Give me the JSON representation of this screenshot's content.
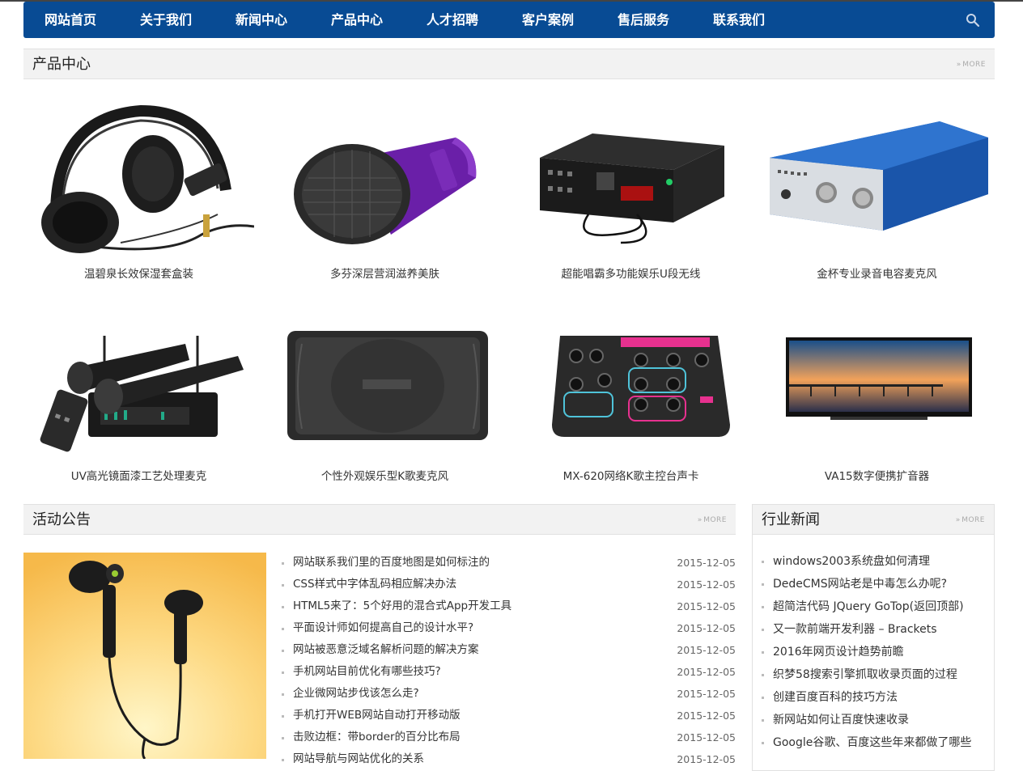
{
  "nav": {
    "items": [
      "网站首页",
      "关于我们",
      "新闻中心",
      "产品中心",
      "人才招聘",
      "客户案例",
      "售后服务",
      "联系我们"
    ]
  },
  "products_section": {
    "title": "产品中心",
    "more": "MORE",
    "items": [
      {
        "name": "温碧泉长效保湿套盒装",
        "icon": "headphones-image"
      },
      {
        "name": "多芬深层营润滋养美肤",
        "icon": "microphone-image"
      },
      {
        "name": "超能唱霸多功能娱乐U段无线",
        "icon": "amplifier-image"
      },
      {
        "name": "金杯专业录音电容麦克风",
        "icon": "audio-interface-image"
      },
      {
        "name": "UV高光镜面漆工艺处理麦克",
        "icon": "wireless-mic-set-image"
      },
      {
        "name": "个性外观娱乐型K歌麦克风",
        "icon": "speaker-image"
      },
      {
        "name": "MX-620网络K歌主控台声卡",
        "icon": "mixer-image"
      },
      {
        "name": "VA15数字便携扩音器",
        "icon": "tv-image"
      }
    ]
  },
  "notice_section": {
    "title": "活动公告",
    "more": "MORE",
    "items": [
      {
        "title": "网站联系我们里的百度地图是如何标注的",
        "date": "2015-12-05"
      },
      {
        "title": "CSS样式中字体乱码相应解决办法",
        "date": "2015-12-05"
      },
      {
        "title": "HTML5来了：5个好用的混合式App开发工具",
        "date": "2015-12-05"
      },
      {
        "title": "平面设计师如何提高自己的设计水平?",
        "date": "2015-12-05"
      },
      {
        "title": "网站被恶意泛域名解析问题的解决方案",
        "date": "2015-12-05"
      },
      {
        "title": "手机网站目前优化有哪些技巧?",
        "date": "2015-12-05"
      },
      {
        "title": "企业微网站步伐该怎么走?",
        "date": "2015-12-05"
      },
      {
        "title": "手机打开WEB网站自动打开移动版",
        "date": "2015-12-05"
      },
      {
        "title": "击败边框：带border的百分比布局",
        "date": "2015-12-05"
      },
      {
        "title": "网站导航与网站优化的关系",
        "date": "2015-12-05"
      }
    ]
  },
  "news_section": {
    "title": "行业新闻",
    "more": "MORE",
    "items": [
      "windows2003系统盘如何清理",
      "DedeCMS网站老是中毒怎么办呢?",
      "超简洁代码 JQuery GoTop(返回顶部)",
      "又一款前端开发利器 – Brackets",
      "2016年网页设计趋势前瞻",
      "织梦58搜索引擎抓取收录页面的过程",
      "创建百度百科的技巧方法",
      "新网站如何让百度快速收录",
      "Google谷歌、百度这些年来都做了哪些"
    ]
  },
  "colors": {
    "nav_bg": "#084b94",
    "section_bg": "#f2f2f2"
  }
}
